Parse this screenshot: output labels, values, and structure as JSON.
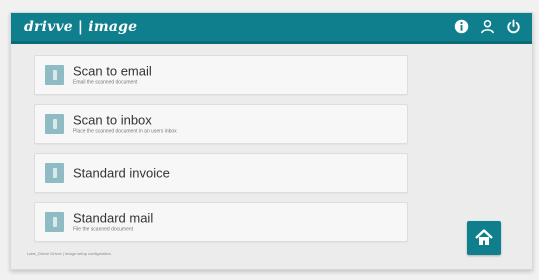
{
  "header": {
    "brand": "drivve | image",
    "icons": [
      "info-icon",
      "user-icon",
      "power-icon"
    ]
  },
  "menu": [
    {
      "title": "Scan to email",
      "description": "Email the scanned document"
    },
    {
      "title": "Scan to inbox",
      "description": "Place the scanned document in an users inbox"
    },
    {
      "title": "Standard invoice",
      "description": ""
    },
    {
      "title": "Standard mail",
      "description": "File the scanned document"
    }
  ],
  "footer": {
    "text": "Labs_Drivve   Drivve | Image setup   configuration"
  },
  "colors": {
    "accent": "#0f7f8d",
    "tile_icon": "#8fbcc4"
  }
}
